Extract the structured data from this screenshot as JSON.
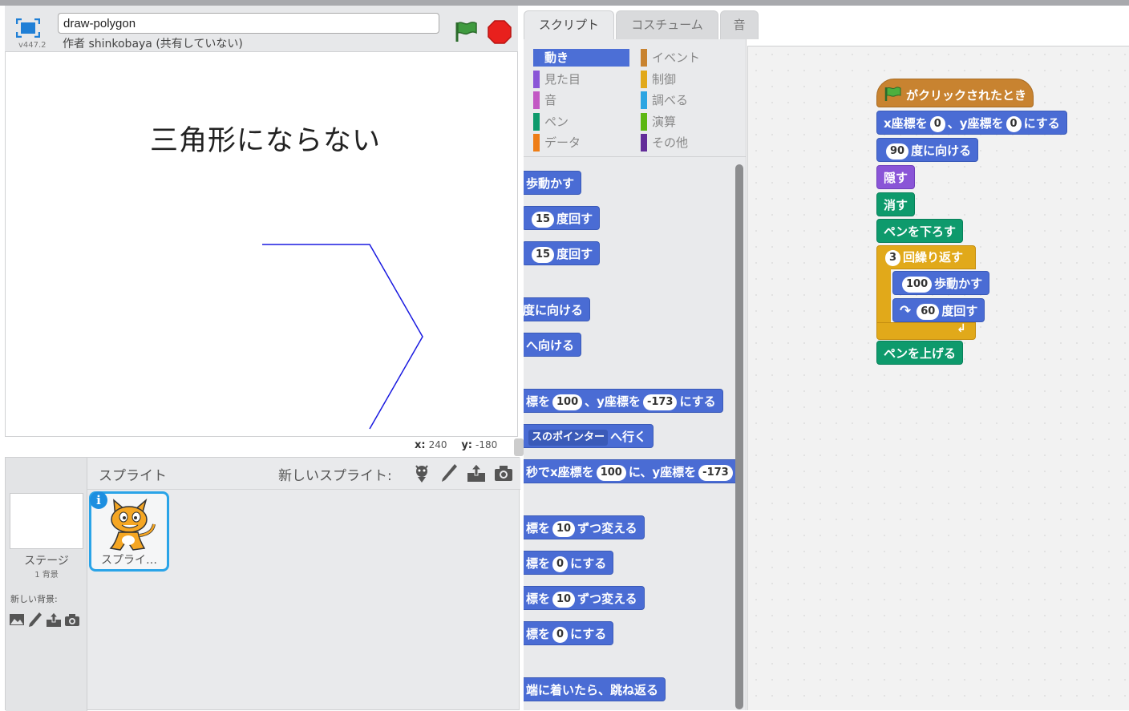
{
  "stage_header": {
    "version": "v447.2",
    "title_value": "draw-polygon",
    "author": "作者 shinkobaya (共有していない)"
  },
  "stage": {
    "text": "三角形にならない",
    "coords": {
      "x_label": "x:",
      "x_value": "240",
      "y_label": "y:",
      "y_value": "-180"
    }
  },
  "sprite_pane": {
    "title": "スプライト",
    "new_sprite_label": "新しいスプライト:",
    "stage_label": "ステージ",
    "stage_bg_count": "1 背景",
    "new_bg_label": "新しい背景:",
    "sprite_name": "スプライ…",
    "info_icon": "i"
  },
  "tabs": {
    "scripts": "スクリプト",
    "costumes": "コスチューム",
    "sounds": "音"
  },
  "categories": {
    "motion": "動き",
    "looks": "見た目",
    "sound": "音",
    "pen": "ペン",
    "data": "データ",
    "events": "イベント",
    "control": "制御",
    "sensing": "調べる",
    "operators": "演算",
    "more": "その他"
  },
  "palette": {
    "move": "歩動かす",
    "turn_right_value": "15",
    "turn_right_label": "度回す",
    "turn_left_value": "15",
    "turn_left_label": "度回す",
    "point_dir": "度に向ける",
    "point_towards": "へ向ける",
    "goto_xy_a": "標を",
    "goto_xy_x": "100",
    "goto_xy_b": "、y座標を",
    "goto_xy_y": "-173",
    "goto_xy_c": "にする",
    "goto_pointer_a": "スのポインター",
    "goto_pointer_b": "へ行く",
    "glide_a": "秒でx座標を",
    "glide_x": "100",
    "glide_b": "に、y座標を",
    "glide_y": "-173",
    "change_x_a": "標を",
    "change_x_v": "10",
    "change_x_b": "ずつ変える",
    "set_x_a": "標を",
    "set_x_v": "0",
    "set_x_b": "にする",
    "change_y_a": "標を",
    "change_y_v": "10",
    "change_y_b": "ずつ変える",
    "set_y_a": "標を",
    "set_y_v": "0",
    "set_y_b": "にする",
    "bounce": "端に着いたら、跳ね返る"
  },
  "script": {
    "hat": "がクリックされたとき",
    "goto_a": "x座標を",
    "goto_x": "0",
    "goto_b": "、y座標を",
    "goto_y": "0",
    "goto_c": "にする",
    "dir_value": "90",
    "dir_label": "度に向ける",
    "hide": "隠す",
    "clear": "消す",
    "pen_down": "ペンを下ろす",
    "repeat_value": "3",
    "repeat_label": "回繰り返す",
    "move_value": "100",
    "move_label": "歩動かす",
    "turn_value": "60",
    "turn_label": "度回す",
    "pen_up": "ペンを上げる"
  },
  "colors": {
    "motion": "#4a6cd4",
    "looks": "#8a55d7",
    "sound": "#c258c4",
    "pen": "#0e9a6c",
    "data": "#ee7d16",
    "events": "#c88330",
    "control": "#e1a91a",
    "sensing": "#2ca5e2",
    "operators": "#5cb712",
    "more": "#632d99",
    "pen_stroke": "#1a1ae0"
  }
}
